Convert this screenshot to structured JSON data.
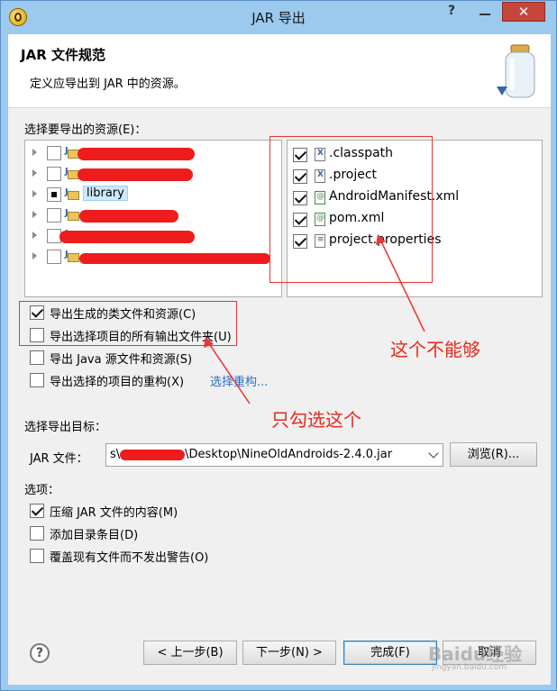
{
  "window": {
    "title": "JAR 导出"
  },
  "header": {
    "title": "JAR 文件规范",
    "description": "定义应导出到 JAR 中的资源。"
  },
  "resources": {
    "label": "选择要导出的资源(E)：",
    "projects": [
      {
        "label": "",
        "state": "unchecked"
      },
      {
        "label": "",
        "state": "unchecked"
      },
      {
        "label": "library",
        "state": "partial"
      },
      {
        "label": "",
        "state": "unchecked"
      },
      {
        "label": "",
        "state": "unchecked"
      },
      {
        "label": "",
        "state": "unchecked"
      }
    ],
    "files": [
      {
        "label": ".classpath",
        "checked": true,
        "icon": "xml-file-icon"
      },
      {
        "label": ".project",
        "checked": true,
        "icon": "xml-file-icon"
      },
      {
        "label": "AndroidManifest.xml",
        "checked": true,
        "icon": "manifest-file-icon"
      },
      {
        "label": "pom.xml",
        "checked": true,
        "icon": "manifest-file-icon"
      },
      {
        "label": "project.properties",
        "checked": true,
        "icon": "properties-file-icon"
      }
    ]
  },
  "options_export": [
    {
      "label": "导出生成的类文件和资源(C)",
      "checked": true
    },
    {
      "label": "导出选择项目的所有输出文件夹(U)",
      "checked": false
    },
    {
      "label": "导出 Java 源文件和资源(S)",
      "checked": false
    },
    {
      "label": "导出选择的项目的重构(X)",
      "checked": false,
      "link": "选择重构..."
    }
  ],
  "annotations": {
    "cannot": "这个不能够",
    "only_this": "只勾选这个"
  },
  "destination": {
    "label": "选择导出目标：",
    "jar_label": "JAR 文件：",
    "jar_prefix": "s\\",
    "jar_suffix": "\\Desktop\\NineOldAndroids-2.4.0.jar",
    "browse_label": "浏览(R)..."
  },
  "options": {
    "label": "选项：",
    "items": [
      {
        "label": "压缩 JAR 文件的内容(M)",
        "checked": true
      },
      {
        "label": "添加目录条目(D)",
        "checked": false
      },
      {
        "label": "覆盖现有文件而不发出警告(O)",
        "checked": false
      }
    ]
  },
  "footer": {
    "back_label": "< 上一步(B)",
    "next_label": "下一步(N) >",
    "finish_label": "完成(F)",
    "cancel_label": "取消",
    "watermark": "Baidu经验",
    "watermark_sub": "jingyan.baidu.com"
  },
  "colors": {
    "annotation": "#e8291c",
    "redaction": "#ee1c1c",
    "link": "#2a6cc4"
  }
}
